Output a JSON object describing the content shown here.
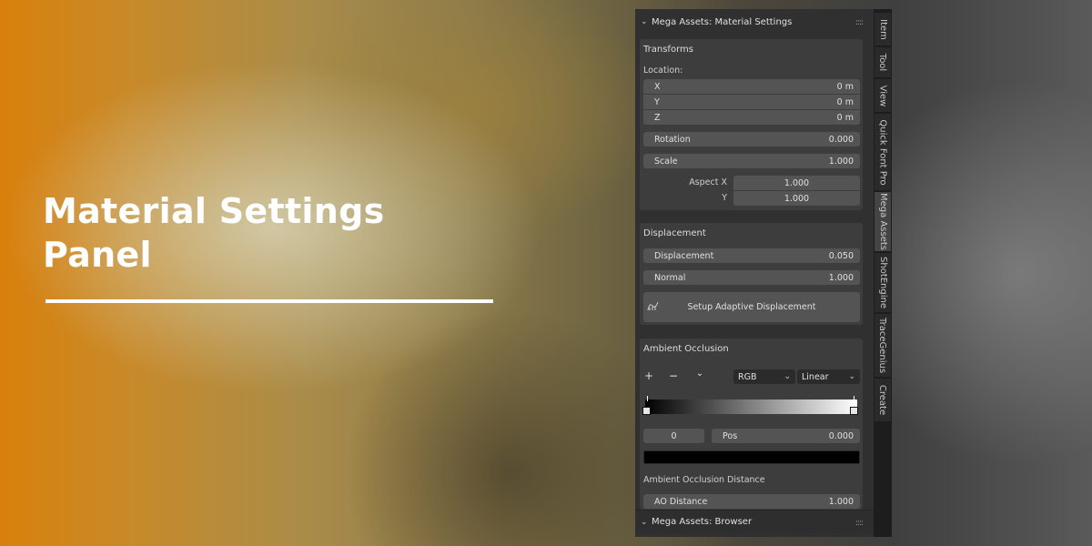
{
  "headline": {
    "line1": "Material Settings",
    "line2": "Panel"
  },
  "panel": {
    "header": {
      "title": "Mega Assets: Material Settings",
      "grip": "::::"
    },
    "transforms": {
      "title": "Transforms",
      "location_label": "Location:",
      "location": [
        {
          "axis": "X",
          "value": "0 m"
        },
        {
          "axis": "Y",
          "value": "0 m"
        },
        {
          "axis": "Z",
          "value": "0 m"
        }
      ],
      "rotation": {
        "label": "Rotation",
        "value": "0.000"
      },
      "scale": {
        "label": "Scale",
        "value": "1.000"
      },
      "aspect_x": {
        "label": "Aspect X",
        "value": "1.000"
      },
      "aspect_y": {
        "label": "Y",
        "value": "1.000"
      }
    },
    "displacement": {
      "title": "Displacement",
      "displacement": {
        "label": "Displacement",
        "value": "0.050"
      },
      "normal": {
        "label": "Normal",
        "value": "1.000"
      },
      "setup_button": "Setup Adaptive Displacement"
    },
    "ambient_occlusion": {
      "title": "Ambient Occlusion",
      "add_icon": "+",
      "remove_icon": "−",
      "menu_icon": "⌄",
      "color_mode": "RGB",
      "interpolation": "Linear",
      "stop_index": "0",
      "pos": {
        "label": "Pos",
        "value": "0.000"
      },
      "stop_color": "#000000",
      "distance_title": "Ambient Occlusion Distance",
      "ao_distance": {
        "label": "AO Distance",
        "value": "1.000"
      }
    },
    "browser_header": {
      "title": "Mega Assets: Browser",
      "grip": "::::"
    }
  },
  "tabs": [
    "Item",
    "Tool",
    "View",
    "Quick Font Pro",
    "Mega Assets",
    "ShotEngine",
    "TraceGenius",
    "Create"
  ],
  "active_tab": "Mega Assets",
  "colors": {
    "accent": "#d9800c",
    "panel_bg": "#303030",
    "field_bg": "#545454"
  }
}
